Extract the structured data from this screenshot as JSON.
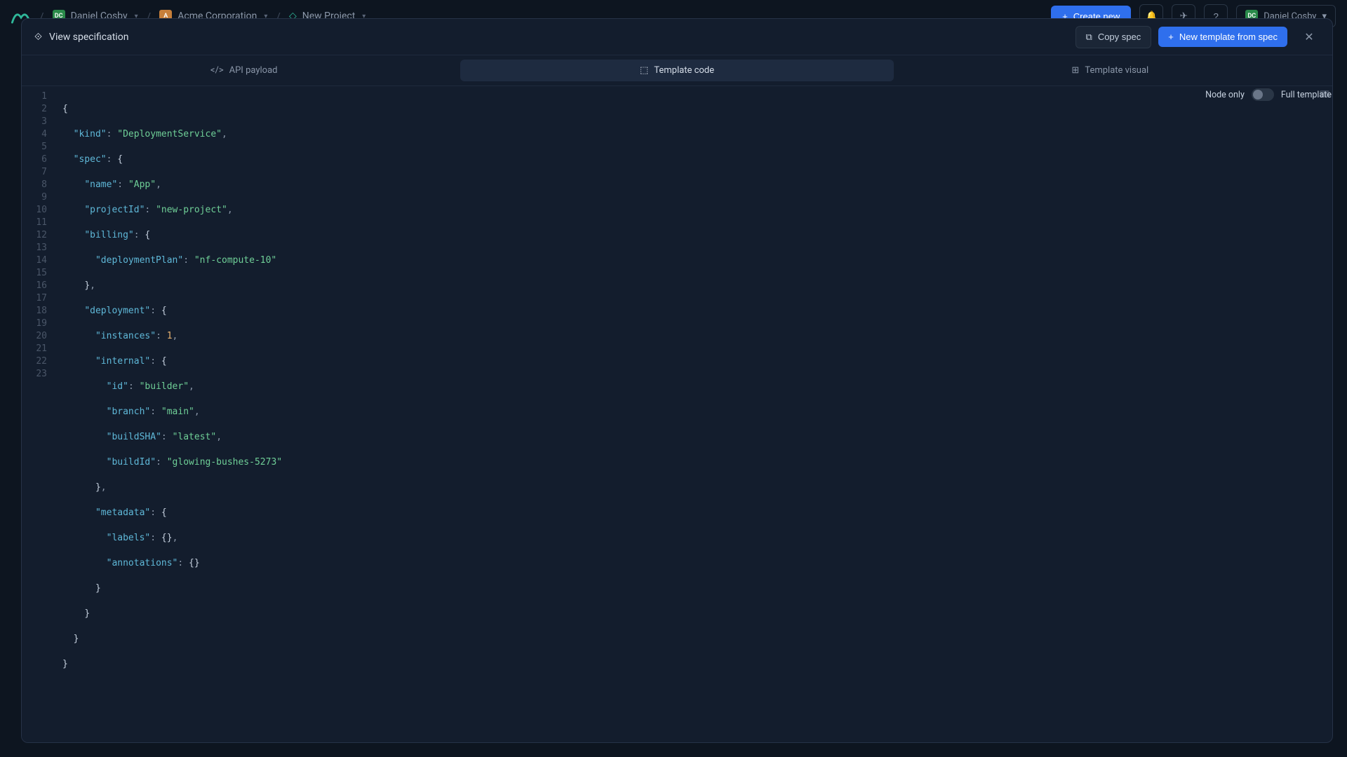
{
  "topbar": {
    "user1_initials": "DC",
    "user1_name": "Daniel Cosby",
    "org_initials": "A",
    "org_name": "Acme Corporation",
    "project_name": "New Project",
    "create_label": "Create new",
    "user2_initials": "DC",
    "user2_name": "Daniel Cosby"
  },
  "modal": {
    "title": "View specification",
    "copy_label": "Copy spec",
    "new_template_label": "New template from spec"
  },
  "tabs": {
    "api": "API payload",
    "code": "Template code",
    "visual": "Template visual"
  },
  "toggle": {
    "left": "Node only",
    "right": "Full template"
  },
  "code": {
    "kind_key": "\"kind\"",
    "kind_val": "\"DeploymentService\"",
    "spec_key": "\"spec\"",
    "name_key": "\"name\"",
    "name_val": "\"App\"",
    "projectId_key": "\"projectId\"",
    "projectId_val": "\"new-project\"",
    "billing_key": "\"billing\"",
    "deploymentPlan_key": "\"deploymentPlan\"",
    "deploymentPlan_val": "\"nf-compute-10\"",
    "deployment_key": "\"deployment\"",
    "instances_key": "\"instances\"",
    "instances_val": "1",
    "internal_key": "\"internal\"",
    "id_key": "\"id\"",
    "id_val": "\"builder\"",
    "branch_key": "\"branch\"",
    "branch_val": "\"main\"",
    "buildSHA_key": "\"buildSHA\"",
    "buildSHA_val": "\"latest\"",
    "buildId_key": "\"buildId\"",
    "buildId_val": "\"glowing-bushes-5273\"",
    "metadata_key": "\"metadata\"",
    "labels_key": "\"labels\"",
    "annotations_key": "\"annotations\""
  },
  "line_numbers": [
    "1",
    "2",
    "3",
    "4",
    "5",
    "6",
    "7",
    "8",
    "9",
    "10",
    "11",
    "12",
    "13",
    "14",
    "15",
    "16",
    "17",
    "18",
    "19",
    "20",
    "21",
    "22",
    "23"
  ]
}
